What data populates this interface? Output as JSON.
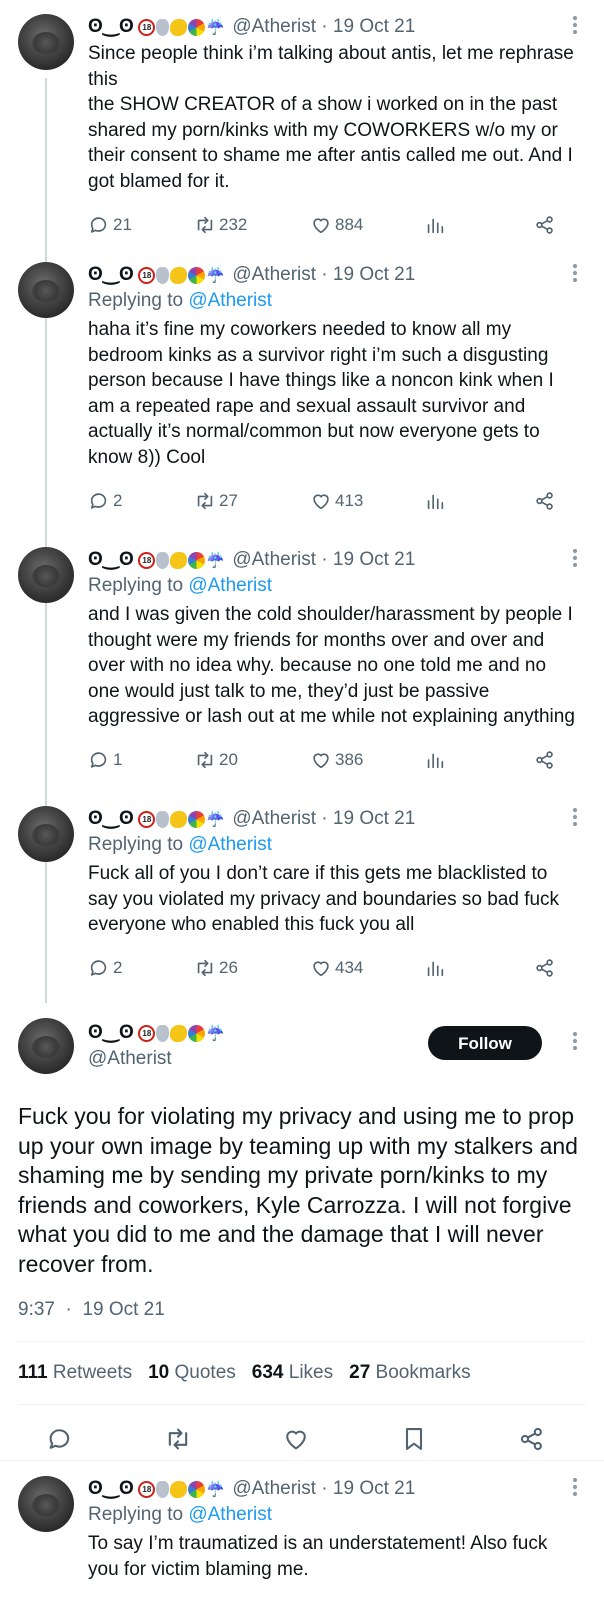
{
  "author": {
    "display_name": "ʘ‿ʘ",
    "emoji_badge": "18",
    "handle": "@Atherist"
  },
  "tweets": [
    {
      "date": "19 Oct 21",
      "reply_to": "",
      "text": "Since people think i’m talking about antis, let me rephrase this\nthe SHOW CREATOR of a show i worked on in the past shared my porn/kinks with my COWORKERS w/o my or their consent to shame me after antis called me out. And I got blamed for it.",
      "replies": "21",
      "retweets": "232",
      "likes": "884"
    },
    {
      "date": "19 Oct 21",
      "reply_to": "@Atherist",
      "text": "haha it’s fine my coworkers needed to know all my bedroom kinks as a survivor right i’m such a disgusting person because I have things like a noncon kink when I am a repeated rape and sexual assault survivor and actually it’s normal/common but now everyone gets to know 8)) Cool",
      "replies": "2",
      "retweets": "27",
      "likes": "413"
    },
    {
      "date": "19 Oct 21",
      "reply_to": "@Atherist",
      "text": "and I was given the cold shoulder/harassment by people I thought were my friends for months over and over and over with no idea why. because no one told me and no one would just talk to me, they’d just be passive aggressive or lash out at me while not explaining anything",
      "replies": "1",
      "retweets": "20",
      "likes": "386"
    },
    {
      "date": "19 Oct 21",
      "reply_to": "@Atherist",
      "text": "Fuck all of you I don’t care if this gets me blacklisted to say you violated my privacy and boundaries so bad fuck everyone who enabled this fuck you all",
      "replies": "2",
      "retweets": "26",
      "likes": "434"
    }
  ],
  "replying_to_label": "Replying to",
  "main_tweet": {
    "follow_label": "Follow",
    "text": "Fuck you for violating my privacy and using me to prop up your own image by teaming up with my stalkers and shaming me by sending my private porn/kinks to my friends and coworkers, Kyle Carrozza. I will not forgive what you did to me and the damage that I will never recover from.",
    "time": "9:37",
    "date": "19 Oct 21",
    "stats": {
      "retweets_count": "111",
      "retweets_label": "Retweets",
      "quotes_count": "10",
      "quotes_label": "Quotes",
      "likes_count": "634",
      "likes_label": "Likes",
      "bookmarks_count": "27",
      "bookmarks_label": "Bookmarks"
    }
  },
  "reply_tweet": {
    "date": "19 Oct 21",
    "reply_to": "@Atherist",
    "text": "To say I’m traumatized is an understatement! Also fuck you for victim blaming me."
  },
  "colors": {
    "accent": "#1d9bf0",
    "muted": "#536471",
    "text": "#0f1419"
  }
}
